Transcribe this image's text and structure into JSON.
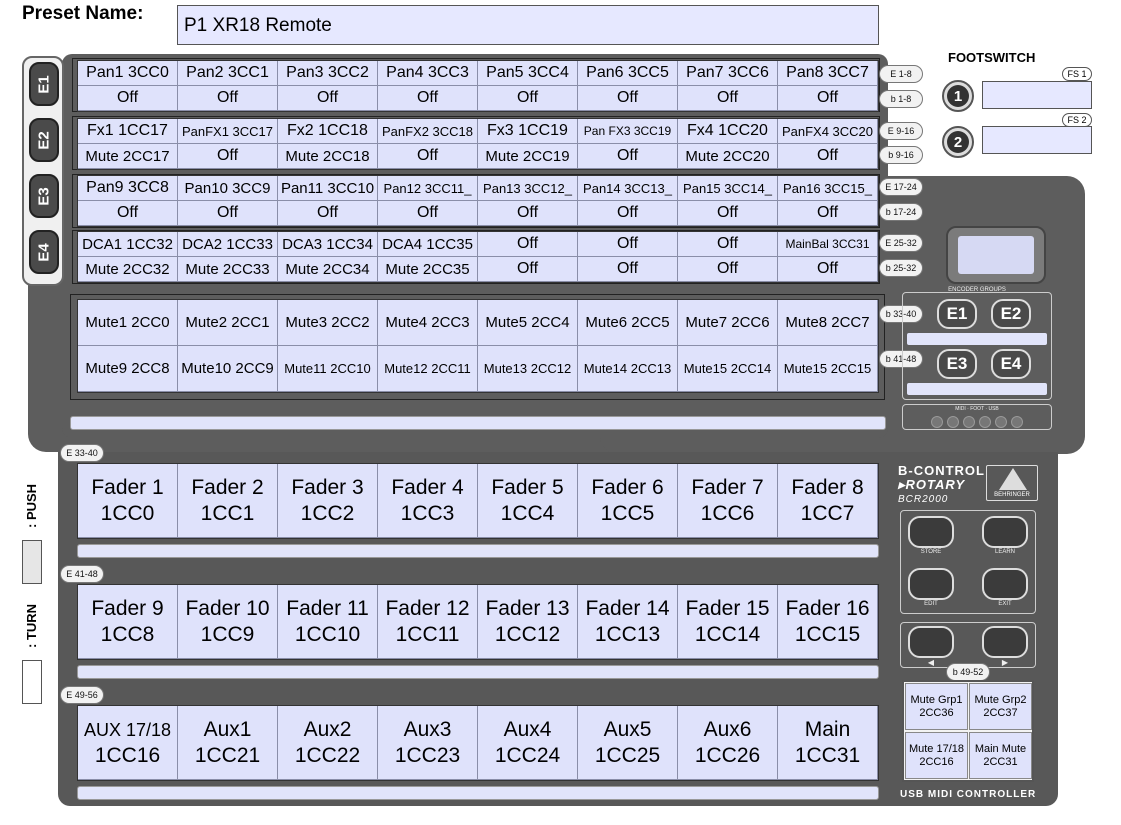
{
  "header": {
    "preset_label": "Preset Name:",
    "preset_value": "P1 XR18 Remote"
  },
  "encoder_tabs": [
    "E1",
    "E2",
    "E3",
    "E4"
  ],
  "row_groups": [
    {
      "tag_top": "E 1-8",
      "tag_bottom": "b 1-8",
      "top": [
        "Pan1 3CC0",
        "Pan2 3CC1",
        "Pan3 3CC2",
        "Pan4 3CC3",
        "Pan5 3CC4",
        "Pan6 3CC5",
        "Pan7 3CC6",
        "Pan8 3CC7"
      ],
      "bottom": [
        "Off",
        "Off",
        "Off",
        "Off",
        "Off",
        "Off",
        "Off",
        "Off"
      ]
    },
    {
      "tag_top": "E 9-16",
      "tag_bottom": "b 9-16",
      "top": [
        "Fx1 1CC17",
        "PanFX1 3CC17",
        "Fx2 1CC18",
        "PanFX2 3CC18",
        "Fx3 1CC19",
        "Pan FX3 3CC19",
        "Fx4 1CC20",
        "PanFX4 3CC20"
      ],
      "bottom": [
        "Mute 2CC17",
        "Off",
        "Mute 2CC18",
        "Off",
        "Mute 2CC19",
        "Off",
        "Mute 2CC20",
        "Off"
      ]
    },
    {
      "tag_top": "E 17-24",
      "tag_bottom": "b 17-24",
      "top": [
        "Pan9 3CC8",
        "Pan10 3CC9",
        "Pan11 3CC10",
        "Pan12 3CC11_",
        "Pan13 3CC12_",
        "Pan14 3CC13_",
        "Pan15 3CC14_",
        "Pan16 3CC15_"
      ],
      "bottom": [
        "Off",
        "Off",
        "Off",
        "Off",
        "Off",
        "Off",
        "Off",
        "Off"
      ]
    },
    {
      "tag_top": "E 25-32",
      "tag_bottom": "b 25-32",
      "top": [
        "DCA1 1CC32",
        "DCA2 1CC33",
        "DCA3 1CC34",
        "DCA4 1CC35",
        "Off",
        "Off",
        "Off",
        "MainBal 3CC31"
      ],
      "bottom": [
        "Mute 2CC32",
        "Mute 2CC33",
        "Mute 2CC34",
        "Mute 2CC35",
        "Off",
        "Off",
        "Off",
        "Off"
      ]
    }
  ],
  "button_rows": {
    "tag_top": "b 33-40",
    "tag_bottom": "b 41-48",
    "top": [
      "Mute1 2CC0",
      "Mute2 2CC1",
      "Mute3 2CC2",
      "Mute4 2CC3",
      "Mute5 2CC4",
      "Mute6 2CC5",
      "Mute7 2CC6",
      "Mute8 2CC7"
    ],
    "bottom": [
      "Mute9 2CC8",
      "Mute10 2CC9",
      "Mute11 2CC10",
      "Mute12 2CC11",
      "Mute13 2CC12",
      "Mute14 2CC13",
      "Mute15 2CC14",
      "Mute15 2CC15"
    ]
  },
  "fader_rows": [
    {
      "tag": "E 33-40",
      "cells": [
        [
          "Fader 1",
          "1CC0"
        ],
        [
          "Fader 2",
          "1CC1"
        ],
        [
          "Fader 3",
          "1CC2"
        ],
        [
          "Fader 4",
          "1CC3"
        ],
        [
          "Fader 5",
          "1CC4"
        ],
        [
          "Fader 6",
          "1CC5"
        ],
        [
          "Fader 7",
          "1CC6"
        ],
        [
          "Fader 8",
          "1CC7"
        ]
      ]
    },
    {
      "tag": "E 41-48",
      "cells": [
        [
          "Fader 9",
          "1CC8"
        ],
        [
          "Fader 10",
          "1CC9"
        ],
        [
          "Fader 11",
          "1CC10"
        ],
        [
          "Fader 12",
          "1CC11"
        ],
        [
          "Fader 13",
          "1CC12"
        ],
        [
          "Fader 14",
          "1CC13"
        ],
        [
          "Fader 15",
          "1CC14"
        ],
        [
          "Fader 16",
          "1CC15"
        ]
      ]
    },
    {
      "tag": "E 49-56",
      "cells": [
        [
          "AUX 17/18",
          "1CC16"
        ],
        [
          "Aux1",
          "1CC21"
        ],
        [
          "Aux2",
          "1CC22"
        ],
        [
          "Aux3",
          "1CC23"
        ],
        [
          "Aux4",
          "1CC24"
        ],
        [
          "Aux5",
          "1CC25"
        ],
        [
          "Aux6",
          "1CC26"
        ],
        [
          "Main",
          "1CC31"
        ]
      ]
    }
  ],
  "footswitch": {
    "title": "FOOTSWITCH",
    "fs1_tag": "FS 1",
    "fs2_tag": "FS 2",
    "fs1_num": "1",
    "fs2_num": "2"
  },
  "encoder_groups": {
    "title": "ENCODER GROUPS",
    "buttons": [
      "E1",
      "E2",
      "E3",
      "E4"
    ]
  },
  "mode_panel": {
    "label": "MIDI · FOOT · USB"
  },
  "brand": {
    "line1": "B-CONTROL",
    "line2": "▸ROTARY",
    "model": "BCR2000",
    "maker": "BEHRINGER",
    "footer": "USB MIDI CONTROLLER"
  },
  "hw_buttons": {
    "store": "STORE",
    "learn": "LEARN",
    "edit": "EDIT",
    "exit": "EXIT",
    "left": "◀",
    "right": "▶"
  },
  "mute_group": {
    "tag": "b 49-52",
    "cells": [
      [
        "Mute Grp1",
        "2CC36"
      ],
      [
        "Mute Grp2",
        "2CC37"
      ],
      [
        "Mute 17/18",
        "2CC16"
      ],
      [
        "Main Mute",
        "2CC31"
      ]
    ]
  },
  "legend": {
    "push": ": PUSH",
    "turn": ": TURN"
  }
}
